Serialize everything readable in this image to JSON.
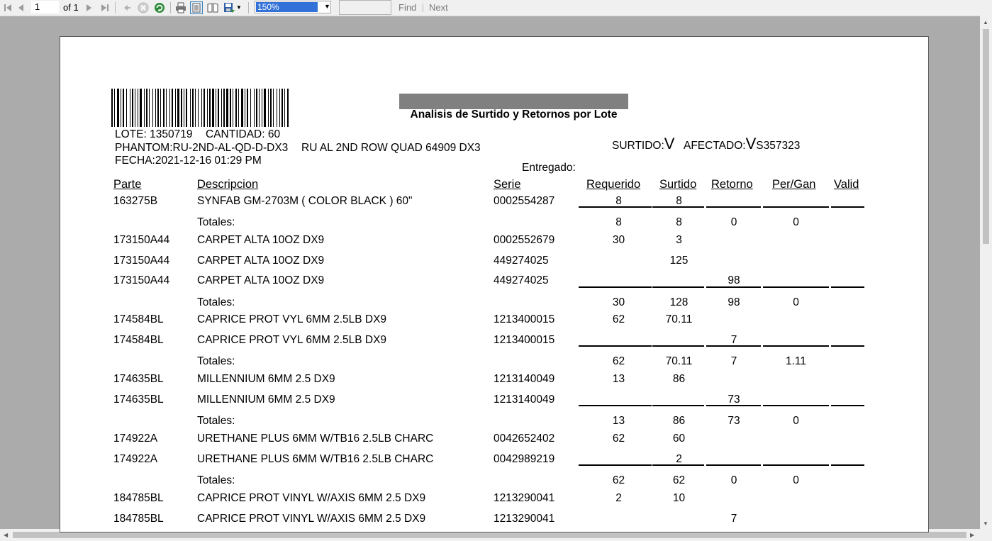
{
  "toolbar": {
    "page_number": "1",
    "page_of": "of 1",
    "zoom": "150%",
    "find_text": "",
    "find_label": "Find",
    "next_label": "Next"
  },
  "report": {
    "title": "Analisis de Surtido y Retornos por Lote",
    "lote": "LOTE: 1350719",
    "cantidad": "CANTIDAD: 60",
    "phantom": "PHANTOM:RU-2ND-AL-QD-D-DX3",
    "phantom_desc": "RU AL 2ND ROW QUAD 64909 DX3",
    "fecha": "FECHA:2021-12-16 01:29 PM",
    "surtido_label": "SURTIDO:",
    "surtido_mark": "V",
    "afectado_label": "AFECTADO:",
    "afectado_mark": "V",
    "afectado_code": "S357323",
    "entregado_label": "Entregado:",
    "headers": {
      "parte": "Parte",
      "descripcion": "Descripcion",
      "serie": "Serie",
      "requerido": "Requerido",
      "surtido": "Surtido",
      "retorno": "Retorno",
      "per_gan": "Per/Gan",
      "valid": "Valid"
    },
    "rows": [
      {
        "parte": "163275B",
        "desc": "SYNFAB GM-2703M ( COLOR BLACK ) 60\"",
        "serie": "0002554287",
        "req": "8",
        "sur": "8",
        "ret": "",
        "pg": ""
      },
      {
        "total": true,
        "label": "Totales:",
        "req": "8",
        "sur": "8",
        "ret": "0",
        "pg": "0"
      },
      {
        "parte": "173150A44",
        "desc": "CARPET ALTA 10OZ DX9",
        "serie": "0002552679",
        "req": "30",
        "sur": "3",
        "ret": "",
        "pg": ""
      },
      {
        "parte": "173150A44",
        "desc": "CARPET ALTA 10OZ DX9",
        "serie": "449274025",
        "req": "",
        "sur": "125",
        "ret": "",
        "pg": ""
      },
      {
        "parte": "173150A44",
        "desc": "CARPET ALTA 10OZ DX9",
        "serie": "449274025",
        "req": "",
        "sur": "",
        "ret": "98",
        "pg": ""
      },
      {
        "total": true,
        "label": "Totales:",
        "req": "30",
        "sur": "128",
        "ret": "98",
        "pg": "0"
      },
      {
        "parte": "174584BL",
        "desc": "CAPRICE PROT VYL 6MM 2.5LB DX9",
        "serie": "1213400015",
        "req": "62",
        "sur": "70.11",
        "ret": "",
        "pg": ""
      },
      {
        "parte": "174584BL",
        "desc": "CAPRICE PROT VYL 6MM 2.5LB DX9",
        "serie": "1213400015",
        "req": "",
        "sur": "",
        "ret": "7",
        "pg": ""
      },
      {
        "total": true,
        "label": "Totales:",
        "req": "62",
        "sur": "70.11",
        "ret": "7",
        "pg": "1.11"
      },
      {
        "parte": "174635BL",
        "desc": "MILLENNIUM 6MM 2.5 DX9",
        "serie": "1213140049",
        "req": "13",
        "sur": "86",
        "ret": "",
        "pg": ""
      },
      {
        "parte": "174635BL",
        "desc": "MILLENNIUM 6MM 2.5 DX9",
        "serie": "1213140049",
        "req": "",
        "sur": "",
        "ret": "73",
        "pg": ""
      },
      {
        "total": true,
        "label": "Totales:",
        "req": "13",
        "sur": "86",
        "ret": "73",
        "pg": "0"
      },
      {
        "parte": "174922A",
        "desc": "URETHANE PLUS 6MM W/TB16 2.5LB CHARC",
        "serie": "0042652402",
        "req": "62",
        "sur": "60",
        "ret": "",
        "pg": ""
      },
      {
        "parte": "174922A",
        "desc": "URETHANE PLUS 6MM W/TB16 2.5LB CHARC",
        "serie": "0042989219",
        "req": "",
        "sur": "2",
        "ret": "",
        "pg": ""
      },
      {
        "total": true,
        "label": "Totales:",
        "req": "62",
        "sur": "62",
        "ret": "0",
        "pg": "0"
      },
      {
        "parte": "184785BL",
        "desc": "CAPRICE PROT VINYL W/AXIS 6MM 2.5 DX9",
        "serie": "1213290041",
        "req": "2",
        "sur": "10",
        "ret": "",
        "pg": ""
      },
      {
        "parte": "184785BL",
        "desc": "CAPRICE PROT VINYL W/AXIS 6MM 2.5 DX9",
        "serie": "1213290041",
        "req": "",
        "sur": "",
        "ret": "7",
        "pg": ""
      }
    ]
  }
}
